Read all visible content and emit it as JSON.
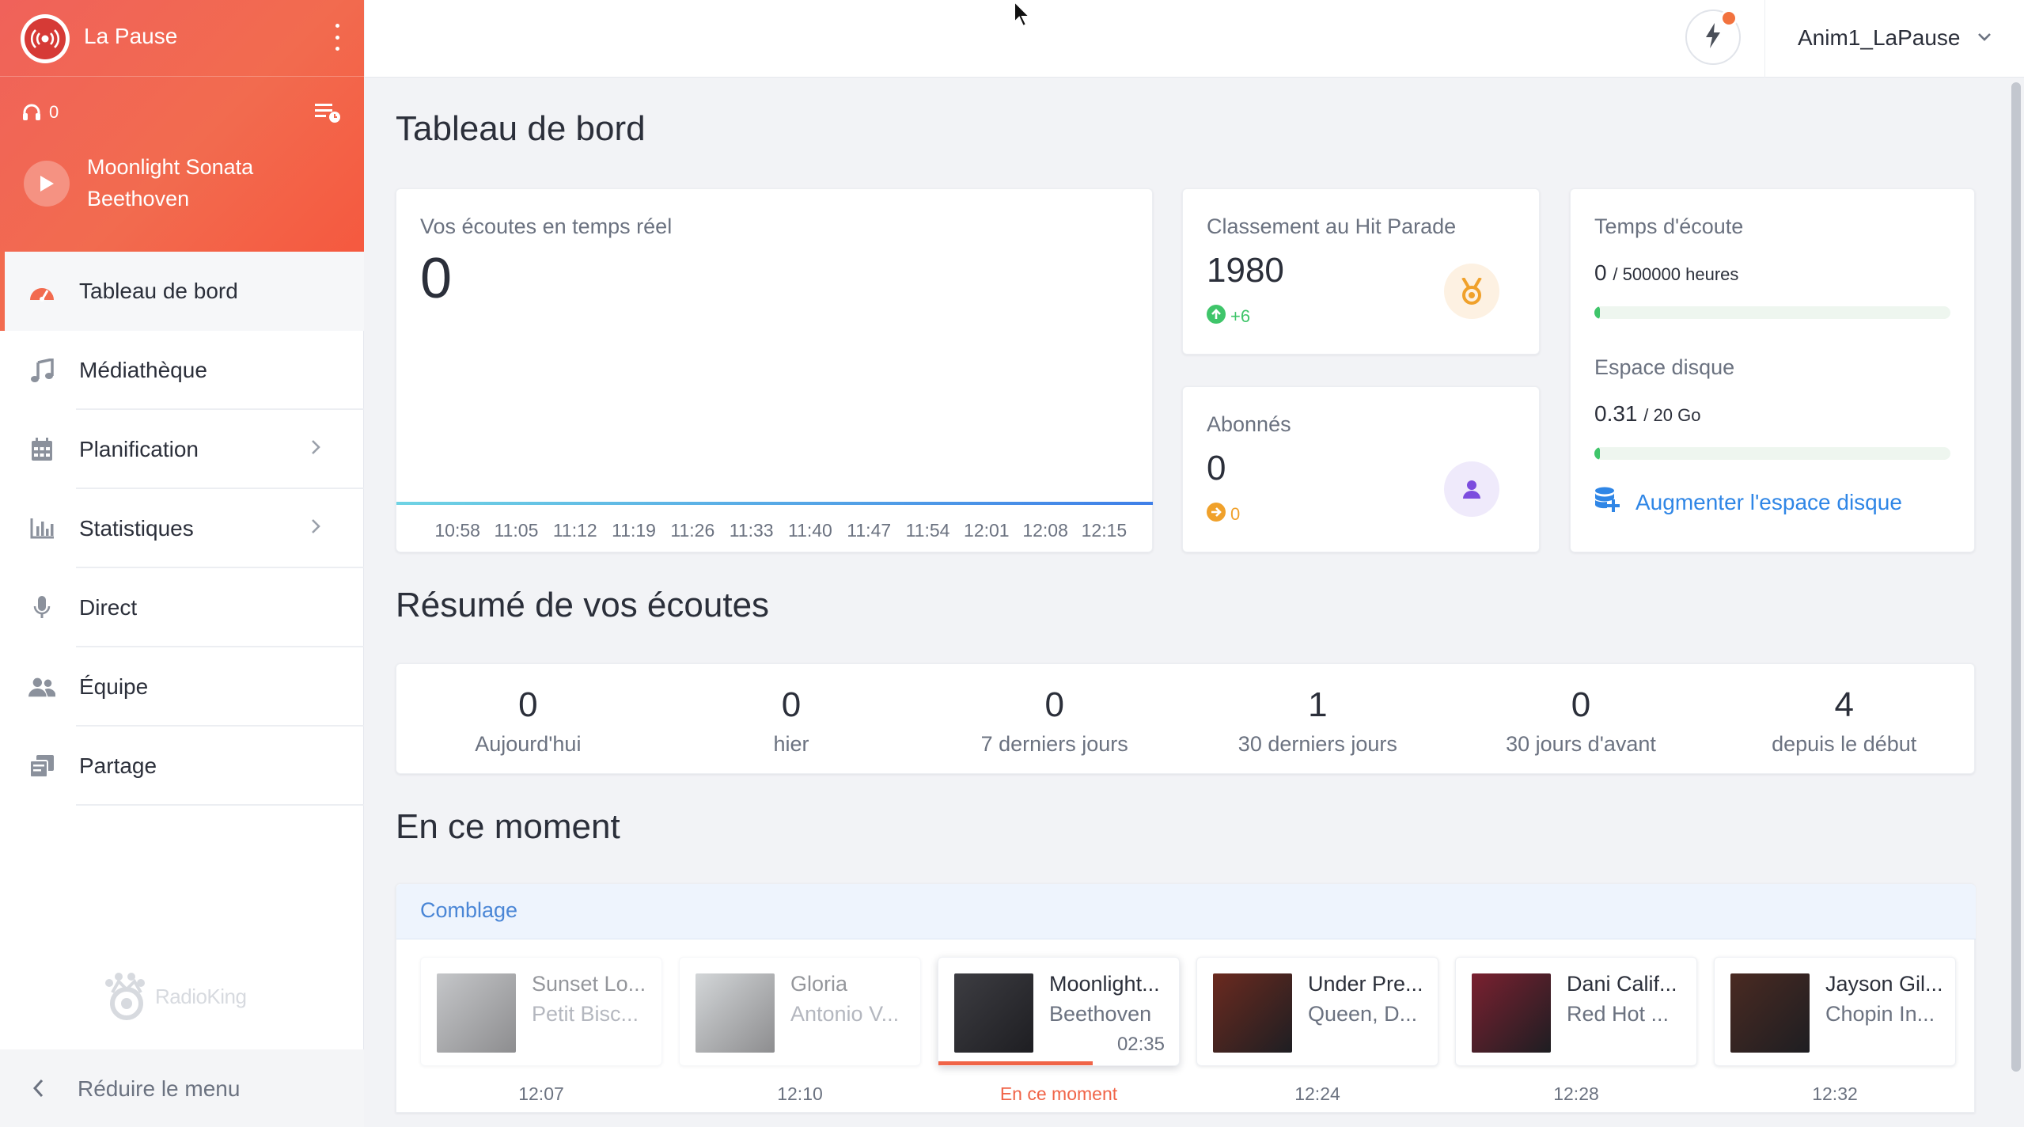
{
  "station": {
    "name": "La Pause",
    "listeners": "0",
    "now_playing": {
      "title": "Moonlight Sonata",
      "artist": "Beethoven"
    }
  },
  "nav": [
    {
      "label": "Tableau de bord",
      "icon": "gauge-icon",
      "active": true,
      "chevron": false
    },
    {
      "label": "Médiathèque",
      "icon": "music-note-icon",
      "active": false,
      "chevron": false
    },
    {
      "label": "Planification",
      "icon": "calendar-icon",
      "active": false,
      "chevron": true
    },
    {
      "label": "Statistiques",
      "icon": "bar-chart-icon",
      "active": false,
      "chevron": true
    },
    {
      "label": "Direct",
      "icon": "microphone-icon",
      "active": false,
      "chevron": false
    },
    {
      "label": "Équipe",
      "icon": "users-icon",
      "active": false,
      "chevron": false
    },
    {
      "label": "Partage",
      "icon": "share-icon",
      "active": false,
      "chevron": false
    }
  ],
  "sidebar_footer": {
    "logo_text": "RadioKing",
    "collapse_label": "Réduire le menu"
  },
  "topbar": {
    "user": "Anim1_LaPause"
  },
  "page_title": "Tableau de bord",
  "realtime": {
    "title": "Vos écoutes en temps réel",
    "value": "0",
    "ticks": [
      "10:58",
      "11:05",
      "11:12",
      "11:19",
      "11:26",
      "11:33",
      "11:40",
      "11:47",
      "11:54",
      "12:01",
      "12:08",
      "12:15"
    ]
  },
  "hitparade": {
    "title": "Classement au Hit Parade",
    "value": "1980",
    "delta": "+6"
  },
  "subscribers": {
    "title": "Abonnés",
    "value": "0",
    "delta": "0"
  },
  "listening_time": {
    "title": "Temps d'écoute",
    "used": "0",
    "total": "/ 500000 heures",
    "fill": 0.0
  },
  "disk": {
    "title": "Espace disque",
    "used": "0.31",
    "total": "/ 20 Go",
    "fill": 0.0155,
    "link": "Augmenter l'espace disque"
  },
  "summary": {
    "title": "Résumé de vos écoutes",
    "items": [
      {
        "value": "0",
        "label": "Aujourd'hui"
      },
      {
        "value": "0",
        "label": "hier"
      },
      {
        "value": "0",
        "label": "7 derniers jours"
      },
      {
        "value": "1",
        "label": "30 derniers jours"
      },
      {
        "value": "0",
        "label": "30 jours d'avant"
      },
      {
        "value": "4",
        "label": "depuis le début"
      }
    ]
  },
  "now": {
    "title": "En ce moment",
    "playlist": "Comblage",
    "tracks": [
      {
        "title": "Sunset Lo...",
        "artist": "Petit Bisc...",
        "time": "12:07",
        "state": "past",
        "cover": "#8c8f94"
      },
      {
        "title": "Gloria",
        "artist": "Antonio V...",
        "time": "12:10",
        "state": "past",
        "cover": "#a8aeb2"
      },
      {
        "title": "Moonlight...",
        "artist": "Beethoven",
        "duration": "02:35",
        "time": "En ce moment",
        "state": "current",
        "progress": 0.64,
        "cover": "#3d3d42"
      },
      {
        "title": "Under Pre...",
        "artist": "Queen, D...",
        "time": "12:24",
        "state": "next",
        "cover": "#6b2a1f"
      },
      {
        "title": "Dani Calif...",
        "artist": "Red Hot ...",
        "time": "12:28",
        "state": "next",
        "cover": "#7a2030"
      },
      {
        "title": "Jayson Gil...",
        "artist": "Chopin In...",
        "time": "12:32",
        "state": "next",
        "cover": "#4a2a22"
      }
    ]
  },
  "colors": {
    "accent": "#f26b4f",
    "link": "#2f86e6",
    "success": "#3fc56a",
    "warning": "#f0a12b",
    "purple": "#7c4dde"
  }
}
